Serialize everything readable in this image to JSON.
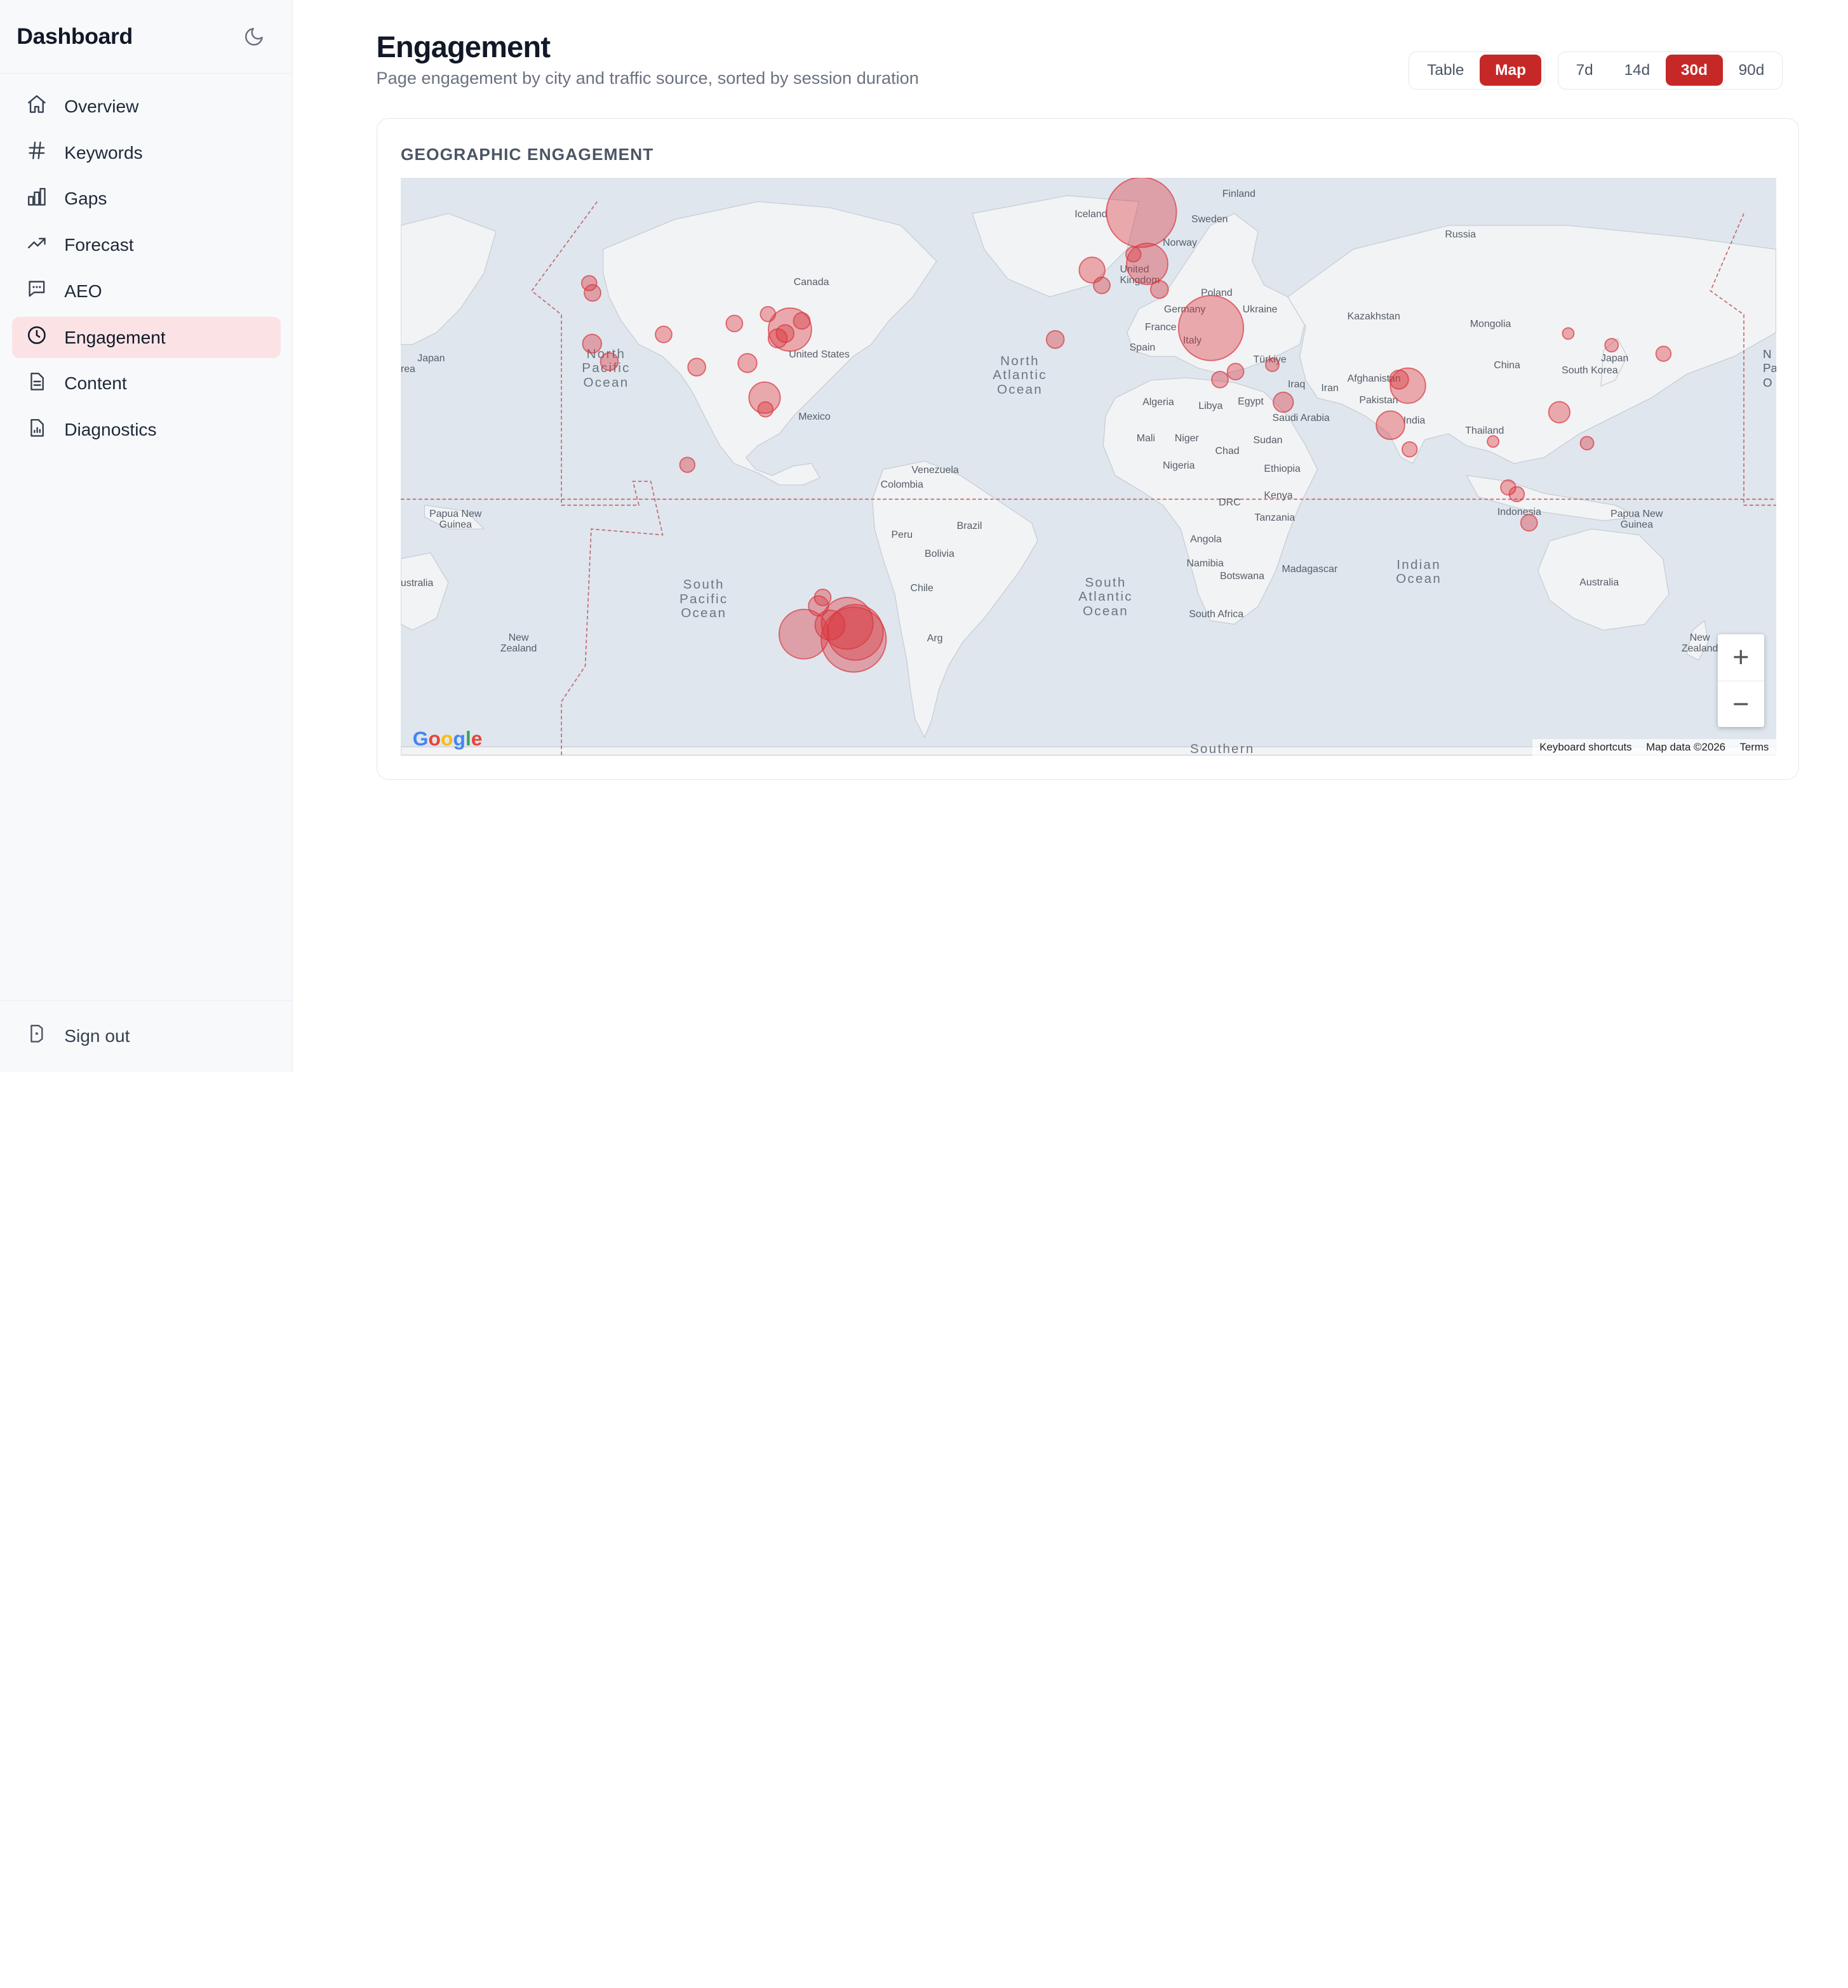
{
  "sidebar": {
    "title": "Dashboard",
    "items": [
      {
        "label": "Overview",
        "icon": "home-icon"
      },
      {
        "label": "Keywords",
        "icon": "hash-icon"
      },
      {
        "label": "Gaps",
        "icon": "bar-chart-icon"
      },
      {
        "label": "Forecast",
        "icon": "trending-up-icon"
      },
      {
        "label": "AEO",
        "icon": "message-icon"
      },
      {
        "label": "Engagement",
        "icon": "clock-icon",
        "active": true
      },
      {
        "label": "Content",
        "icon": "file-text-icon"
      },
      {
        "label": "Diagnostics",
        "icon": "file-chart-icon"
      }
    ],
    "footer": {
      "label": "Sign out",
      "icon": "sign-out-icon"
    }
  },
  "header": {
    "title": "Engagement",
    "subtitle": "Page engagement by city and traffic source, sorted by session duration"
  },
  "view_toggle": {
    "options": [
      "Table",
      "Map"
    ],
    "selected": "Map"
  },
  "range_toggle": {
    "options": [
      "7d",
      "14d",
      "30d",
      "90d"
    ],
    "selected": "30d"
  },
  "card": {
    "title": "GEOGRAPHIC ENGAGEMENT"
  },
  "map": {
    "labels": {
      "finland": "Finland",
      "sweden": "Sweden",
      "norway": "Norway",
      "iceland": "Iceland",
      "russia": "Russia",
      "uk": "United Kingdom",
      "poland": "Poland",
      "germany": "Germany",
      "ukraine": "Ukraine",
      "france": "France",
      "kazakhstan": "Kazakhstan",
      "mongolia": "Mongolia",
      "italy": "Italy",
      "spain": "Spain",
      "turkiye": "Türkiye",
      "japan_e": "Japan",
      "japan_w": "Japan",
      "china": "China",
      "south_korea": "South Korea",
      "afghanistan": "Afghanistan",
      "iran": "Iran",
      "iraq": "Iraq",
      "pakistan": "Pakistan",
      "algeria": "Algeria",
      "libya": "Libya",
      "egypt": "Egypt",
      "saudi": "Saudi Arabia",
      "india": "India",
      "thailand": "Thailand",
      "mali": "Mali",
      "niger": "Niger",
      "chad": "Chad",
      "sudan": "Sudan",
      "nigeria": "Nigeria",
      "ethiopia": "Ethiopia",
      "kenya": "Kenya",
      "drc": "DRC",
      "tanzania": "Tanzania",
      "indonesia": "Indonesia",
      "png_w": "Papua New Guinea",
      "png_e": "Papua New Guinea",
      "canada": "Canada",
      "us": "United States",
      "mexico": "Mexico",
      "venezuela": "Venezuela",
      "colombia": "Colombia",
      "brazil": "Brazil",
      "peru": "Peru",
      "bolivia": "Bolivia",
      "chile": "Chile",
      "arg": "Arg",
      "angola": "Angola",
      "namibia": "Namibia",
      "botswana": "Botswana",
      "madagascar": "Madagascar",
      "south_africa": "South Africa",
      "australia_w": "ustralia",
      "australia": "Australia",
      "nz_w": "New Zealand",
      "nz_e": "New Zealand",
      "rea": "rea",
      "n_edge": "N Pa O"
    },
    "oceans": {
      "north_pacific": "North Pacific Ocean",
      "north_atlantic": "North Atlantic Ocean",
      "south_pacific": "South Pacific Ocean",
      "south_atlantic": "South Atlantic Ocean",
      "indian": "Indian Ocean",
      "southern": "Southern"
    },
    "bubble_color": "#d9363e",
    "cities": [
      {
        "lon": -74.0,
        "lat": 40.7,
        "value": 42
      },
      {
        "lon": -77.0,
        "lat": 38.9,
        "value": 8
      },
      {
        "lon": -71.1,
        "lat": 42.4,
        "value": 6
      },
      {
        "lon": -75.2,
        "lat": 39.9,
        "value": 7
      },
      {
        "lon": -79.4,
        "lat": 43.7,
        "value": 5
      },
      {
        "lon": -84.4,
        "lat": 33.7,
        "value": 8
      },
      {
        "lon": -80.2,
        "lat": 25.8,
        "value": 22
      },
      {
        "lon": -80.0,
        "lat": 23.0,
        "value": 5
      },
      {
        "lon": -87.6,
        "lat": 41.9,
        "value": 6
      },
      {
        "lon": -96.8,
        "lat": 32.8,
        "value": 7
      },
      {
        "lon": -104.9,
        "lat": 39.7,
        "value": 6
      },
      {
        "lon": -122.4,
        "lat": 37.8,
        "value": 8
      },
      {
        "lon": -122.3,
        "lat": 47.6,
        "value": 6
      },
      {
        "lon": -123.1,
        "lat": 49.3,
        "value": 5
      },
      {
        "lon": -118.2,
        "lat": 34.0,
        "value": 7
      },
      {
        "lon": -99.1,
        "lat": 9.0,
        "value": 5
      },
      {
        "lon": -58.4,
        "lat": -34.6,
        "value": 95
      },
      {
        "lon": -58.0,
        "lat": -33.0,
        "value": 70
      },
      {
        "lon": -60.0,
        "lat": -31.0,
        "value": 60
      },
      {
        "lon": -64.2,
        "lat": -31.4,
        "value": 20
      },
      {
        "lon": -70.6,
        "lat": -33.4,
        "value": 55
      },
      {
        "lon": -67.0,
        "lat": -27.0,
        "value": 9
      },
      {
        "lon": -66.0,
        "lat": -25.0,
        "value": 6
      },
      {
        "lon": -0.1,
        "lat": 51.5,
        "value": 15
      },
      {
        "lon": 2.3,
        "lat": 48.9,
        "value": 6
      },
      {
        "lon": 13.4,
        "lat": 52.5,
        "value": 38
      },
      {
        "lon": 12.0,
        "lat": 60.0,
        "value": 110
      },
      {
        "lon": 10.0,
        "lat": 54.0,
        "value": 5
      },
      {
        "lon": 16.4,
        "lat": 48.2,
        "value": 7
      },
      {
        "lon": -9.1,
        "lat": 38.7,
        "value": 7
      },
      {
        "lon": 29.0,
        "lat": 41.0,
        "value": 95
      },
      {
        "lon": 35.0,
        "lat": 31.8,
        "value": 6
      },
      {
        "lon": 31.2,
        "lat": 30.0,
        "value": 6
      },
      {
        "lon": 46.7,
        "lat": 24.7,
        "value": 9
      },
      {
        "lon": 44.0,
        "lat": 33.3,
        "value": 4
      },
      {
        "lon": 72.9,
        "lat": 19.1,
        "value": 18
      },
      {
        "lon": 77.2,
        "lat": 28.6,
        "value": 28
      },
      {
        "lon": 75.0,
        "lat": 30.0,
        "value": 8
      },
      {
        "lon": 77.6,
        "lat": 13.0,
        "value": 5
      },
      {
        "lon": 114.2,
        "lat": 22.3,
        "value": 10
      },
      {
        "lon": 103.8,
        "lat": 1.35,
        "value": 5
      },
      {
        "lon": 106.8,
        "lat": -6.2,
        "value": 6
      },
      {
        "lon": 101.7,
        "lat": 3.1,
        "value": 5
      },
      {
        "lon": 121.0,
        "lat": 14.6,
        "value": 4
      },
      {
        "lon": 139.7,
        "lat": 35.7,
        "value": 5
      },
      {
        "lon": 127.0,
        "lat": 37.5,
        "value": 4
      },
      {
        "lon": 116.4,
        "lat": 39.9,
        "value": 3
      },
      {
        "lon": 174.8,
        "lat": -36.9,
        "value": 4
      },
      {
        "lon": 98.0,
        "lat": 15.0,
        "value": 3
      }
    ]
  },
  "map_ui": {
    "zoom_in": "+",
    "zoom_out": "−",
    "attribution": [
      "Keyboard shortcuts",
      "Map data ©2026",
      "Terms"
    ],
    "brand": "Google"
  }
}
